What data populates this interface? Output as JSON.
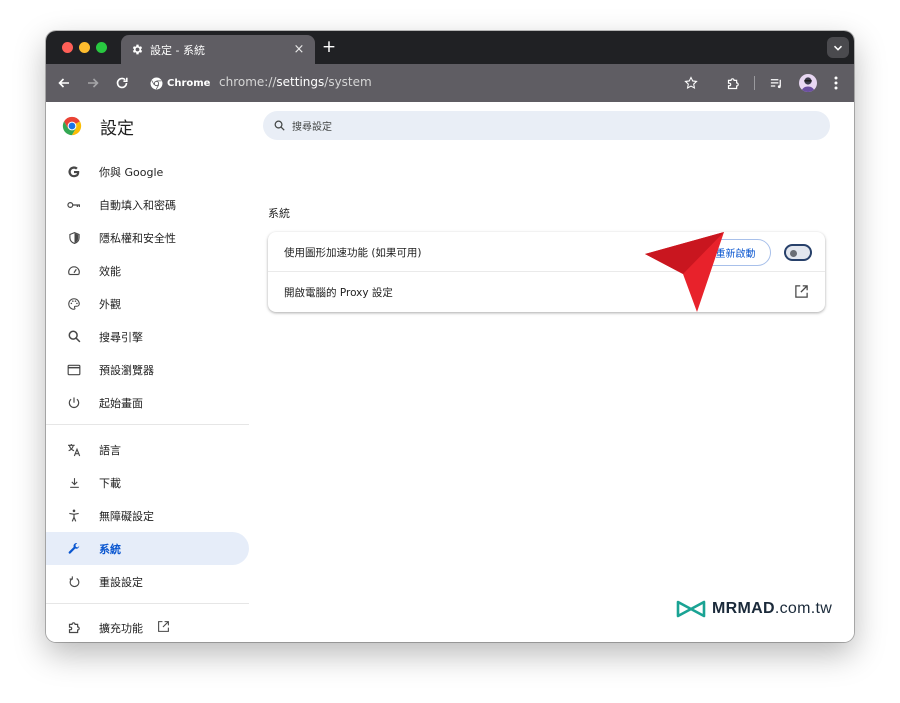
{
  "window": {
    "tab_title": "設定 - 系統",
    "tab_close": "×",
    "new_tab": "+"
  },
  "toolbar": {
    "chip_label": "Chrome",
    "url_scheme": "chrome://",
    "url_main": "settings",
    "url_path": "/system"
  },
  "settings": {
    "title": "設定",
    "search_placeholder": "搜尋設定"
  },
  "sidebar": {
    "items": [
      {
        "label": "你與 Google",
        "icon": "google-g-icon"
      },
      {
        "label": "自動填入和密碼",
        "icon": "key-icon"
      },
      {
        "label": "隱私權和安全性",
        "icon": "shield-icon"
      },
      {
        "label": "效能",
        "icon": "speedometer-icon"
      },
      {
        "label": "外觀",
        "icon": "palette-icon"
      },
      {
        "label": "搜尋引擎",
        "icon": "search-icon"
      },
      {
        "label": "預設瀏覽器",
        "icon": "browser-window-icon"
      },
      {
        "label": "起始畫面",
        "icon": "power-icon"
      },
      {
        "label": "語言",
        "icon": "translate-icon"
      },
      {
        "label": "下載",
        "icon": "download-icon"
      },
      {
        "label": "無障礙設定",
        "icon": "accessibility-icon"
      },
      {
        "label": "系統",
        "icon": "wrench-icon",
        "active": true
      },
      {
        "label": "重設設定",
        "icon": "reset-icon"
      },
      {
        "label": "擴充功能",
        "icon": "puzzle-icon"
      }
    ]
  },
  "system": {
    "section_title": "系統",
    "hardware_accel_label": "使用圖形加速功能 (如果可用)",
    "relaunch_label": "重新啟動",
    "hardware_accel_enabled": false,
    "proxy_label": "開啟電腦的 Proxy 設定"
  },
  "watermark": {
    "brand": "MRMAD",
    "domain": ".com.tw"
  },
  "colors": {
    "accent": "#0b57d0",
    "annotation_arrow": "#e8222b",
    "watermark_logo": "#1aa394"
  }
}
